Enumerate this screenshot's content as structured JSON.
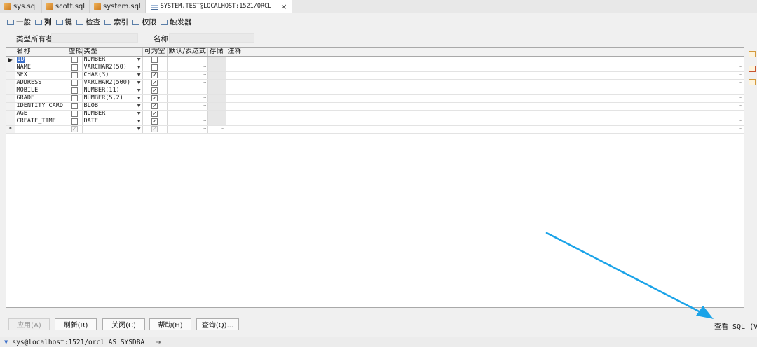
{
  "tabs": [
    {
      "label": "sys.sql",
      "icon": "sql-file-icon"
    },
    {
      "label": "scott.sql",
      "icon": "sql-file-icon"
    },
    {
      "label": "system.sql",
      "icon": "sql-file-icon"
    },
    {
      "label": "SYSTEM.TEST@LOCALHOST:1521/ORCL",
      "icon": "table-icon",
      "active": true,
      "close": "×"
    }
  ],
  "subtabs": [
    {
      "label": "一般",
      "icon": "general-icon"
    },
    {
      "label": "列",
      "icon": "columns-icon",
      "selected": true
    },
    {
      "label": "键",
      "icon": "keys-icon"
    },
    {
      "label": "检查",
      "icon": "checks-icon"
    },
    {
      "label": "索引",
      "icon": "indexes-icon"
    },
    {
      "label": "权限",
      "icon": "privileges-icon"
    },
    {
      "label": "触发器",
      "icon": "triggers-icon"
    }
  ],
  "owner": {
    "type_owner_label": "类型所有者",
    "name_label": "名称",
    "type_owner_value": "",
    "name_value": ""
  },
  "columns_header": [
    "名称",
    "虚拟",
    "类型",
    "可为空",
    "默认/表达式",
    "存储",
    "注释"
  ],
  "rows": [
    {
      "indicator": "▶",
      "name": "ID",
      "virtual": false,
      "type": "NUMBER",
      "nullable": false
    },
    {
      "indicator": "",
      "name": "NAME",
      "virtual": false,
      "type": "VARCHAR2(50)",
      "nullable": false
    },
    {
      "indicator": "",
      "name": "SEX",
      "virtual": false,
      "type": "CHAR(3)",
      "nullable": true
    },
    {
      "indicator": "",
      "name": "ADDRESS",
      "virtual": false,
      "type": "VARCHAR2(500)",
      "nullable": true
    },
    {
      "indicator": "",
      "name": "MOBILE",
      "virtual": false,
      "type": "NUMBER(11)",
      "nullable": true
    },
    {
      "indicator": "",
      "name": "GRADE",
      "virtual": false,
      "type": "NUMBER(5,2)",
      "nullable": true
    },
    {
      "indicator": "",
      "name": "IDENTITY_CARD",
      "virtual": false,
      "type": "BLOB",
      "nullable": true
    },
    {
      "indicator": "",
      "name": "AGE",
      "virtual": false,
      "type": "NUMBER",
      "nullable": true
    },
    {
      "indicator": "",
      "name": "CREATE_TIME",
      "virtual": false,
      "type": "DATE",
      "nullable": true
    },
    {
      "indicator": "*",
      "name": "",
      "virtual": true,
      "type": "",
      "nullable": true,
      "new": true
    }
  ],
  "ellipsis": "···",
  "buttons": {
    "apply": "应用(A)",
    "refresh": "刷新(R)",
    "close": "关闭(C)",
    "help": "帮助(H)",
    "query": "查询(Q)...",
    "view_sql": "查看 SQL (V)"
  },
  "status": {
    "connection": "sys@localhost:1521/orcl AS SYSDBA",
    "pin": "⇥"
  },
  "colors": {
    "arrow": "#1aa3e8",
    "selection": "#3a6ec9"
  }
}
